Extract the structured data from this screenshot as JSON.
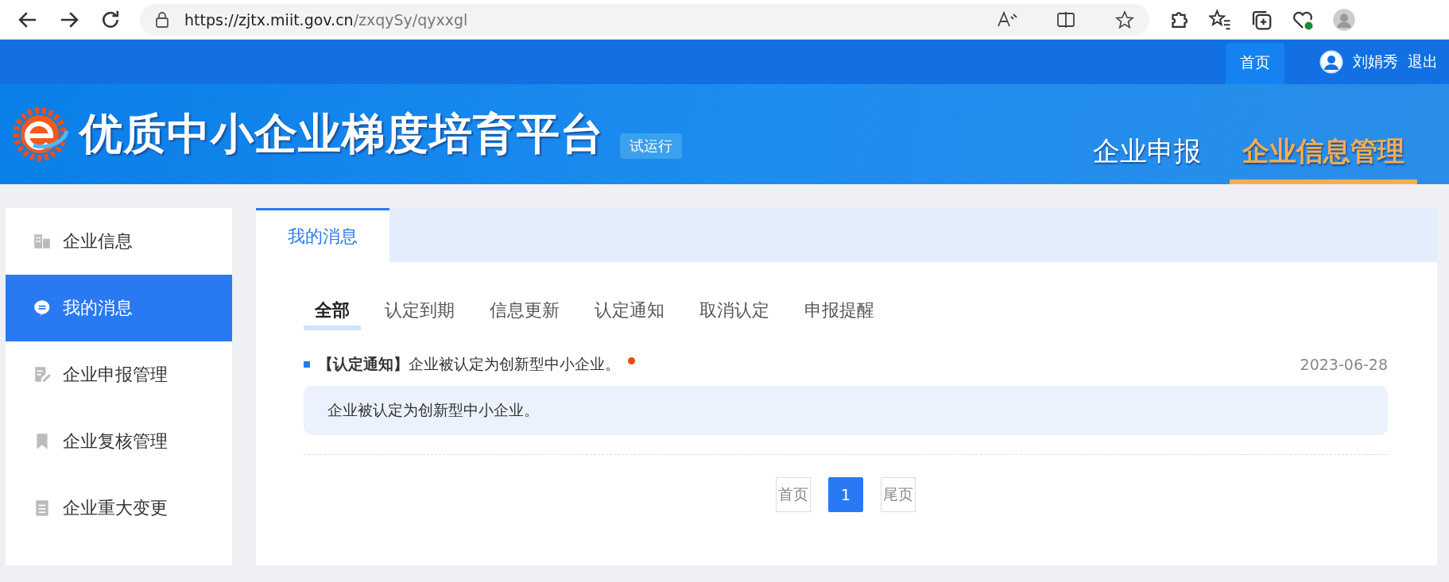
{
  "browser": {
    "url_host": "https://zjtx.miit.gov.cn",
    "url_path": "/zxqySy/qyxxgl"
  },
  "top_bar": {
    "home_link": "首页",
    "user_name": "刘娟秀",
    "logout": "退出"
  },
  "banner": {
    "title": "优质中小企业梯度培育平台",
    "badge": "试运行",
    "nav": [
      {
        "label": "企业申报",
        "selected": false
      },
      {
        "label": "企业信息管理",
        "selected": true
      }
    ]
  },
  "sidebar": {
    "items": [
      {
        "label": "企业信息",
        "selected": false
      },
      {
        "label": "我的消息",
        "selected": true
      },
      {
        "label": "企业申报管理",
        "selected": false
      },
      {
        "label": "企业复核管理",
        "selected": false
      },
      {
        "label": "企业重大变更",
        "selected": false
      }
    ]
  },
  "panel": {
    "tab": "我的消息",
    "filters": [
      {
        "label": "全部",
        "selected": true
      },
      {
        "label": "认定到期",
        "selected": false
      },
      {
        "label": "信息更新",
        "selected": false
      },
      {
        "label": "认定通知",
        "selected": false
      },
      {
        "label": "取消认定",
        "selected": false
      },
      {
        "label": "申报提醒",
        "selected": false
      }
    ],
    "messages": [
      {
        "title": "**【认定通知】**企业被认定为创新型中小企业。",
        "unread": true,
        "date": "2023-06-28",
        "body": "企业被认定为创新型中小企业。"
      }
    ],
    "pagination": {
      "first": "首页",
      "pages": [
        {
          "label": "1",
          "selected": true
        }
      ],
      "last": "尾页"
    }
  }
}
